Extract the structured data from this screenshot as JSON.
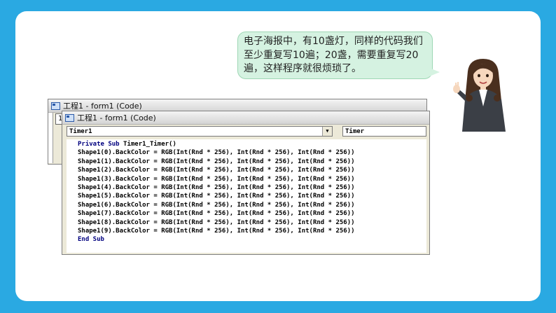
{
  "bubble": {
    "text": "电子海报中，有10盏灯，同样的代码我们至少重复写10遍；20盏，需要重复写20遍，这样程序就很烦琐了。"
  },
  "window_back": {
    "title": "工程1 - form1 (Code)",
    "inner_label": "1"
  },
  "window_front": {
    "title": "工程1 - form1 (Code)",
    "object_combo": "Timer1",
    "procedure_combo": "Timer",
    "combo_arrow": "▼"
  },
  "code": {
    "header_kw": "Private Sub",
    "header_rest": " Timer1_Timer()",
    "lines": [
      "Shape1(0).BackColor = RGB(Int(Rnd * 256), Int(Rnd * 256), Int(Rnd * 256))",
      "Shape1(1).BackColor = RGB(Int(Rnd * 256), Int(Rnd * 256), Int(Rnd * 256))",
      "Shape1(2).BackColor = RGB(Int(Rnd * 256), Int(Rnd * 256), Int(Rnd * 256))",
      "Shape1(3).BackColor = RGB(Int(Rnd * 256), Int(Rnd * 256), Int(Rnd * 256))",
      "Shape1(4).BackColor = RGB(Int(Rnd * 256), Int(Rnd * 256), Int(Rnd * 256))",
      "Shape1(5).BackColor = RGB(Int(Rnd * 256), Int(Rnd * 256), Int(Rnd * 256))",
      "Shape1(6).BackColor = RGB(Int(Rnd * 256), Int(Rnd * 256), Int(Rnd * 256))",
      "Shape1(7).BackColor = RGB(Int(Rnd * 256), Int(Rnd * 256), Int(Rnd * 256))",
      "Shape1(8).BackColor = RGB(Int(Rnd * 256), Int(Rnd * 256), Int(Rnd * 256))",
      "Shape1(9).BackColor = RGB(Int(Rnd * 256), Int(Rnd * 256), Int(Rnd * 256))"
    ],
    "footer": "End Sub"
  },
  "colors": {
    "background": "#2aa9e2",
    "bubble": "#d5f2e1",
    "keyword": "#00007f"
  },
  "icons": {
    "presenter": "presenter-illustration",
    "app": "vb-code-window-icon"
  }
}
